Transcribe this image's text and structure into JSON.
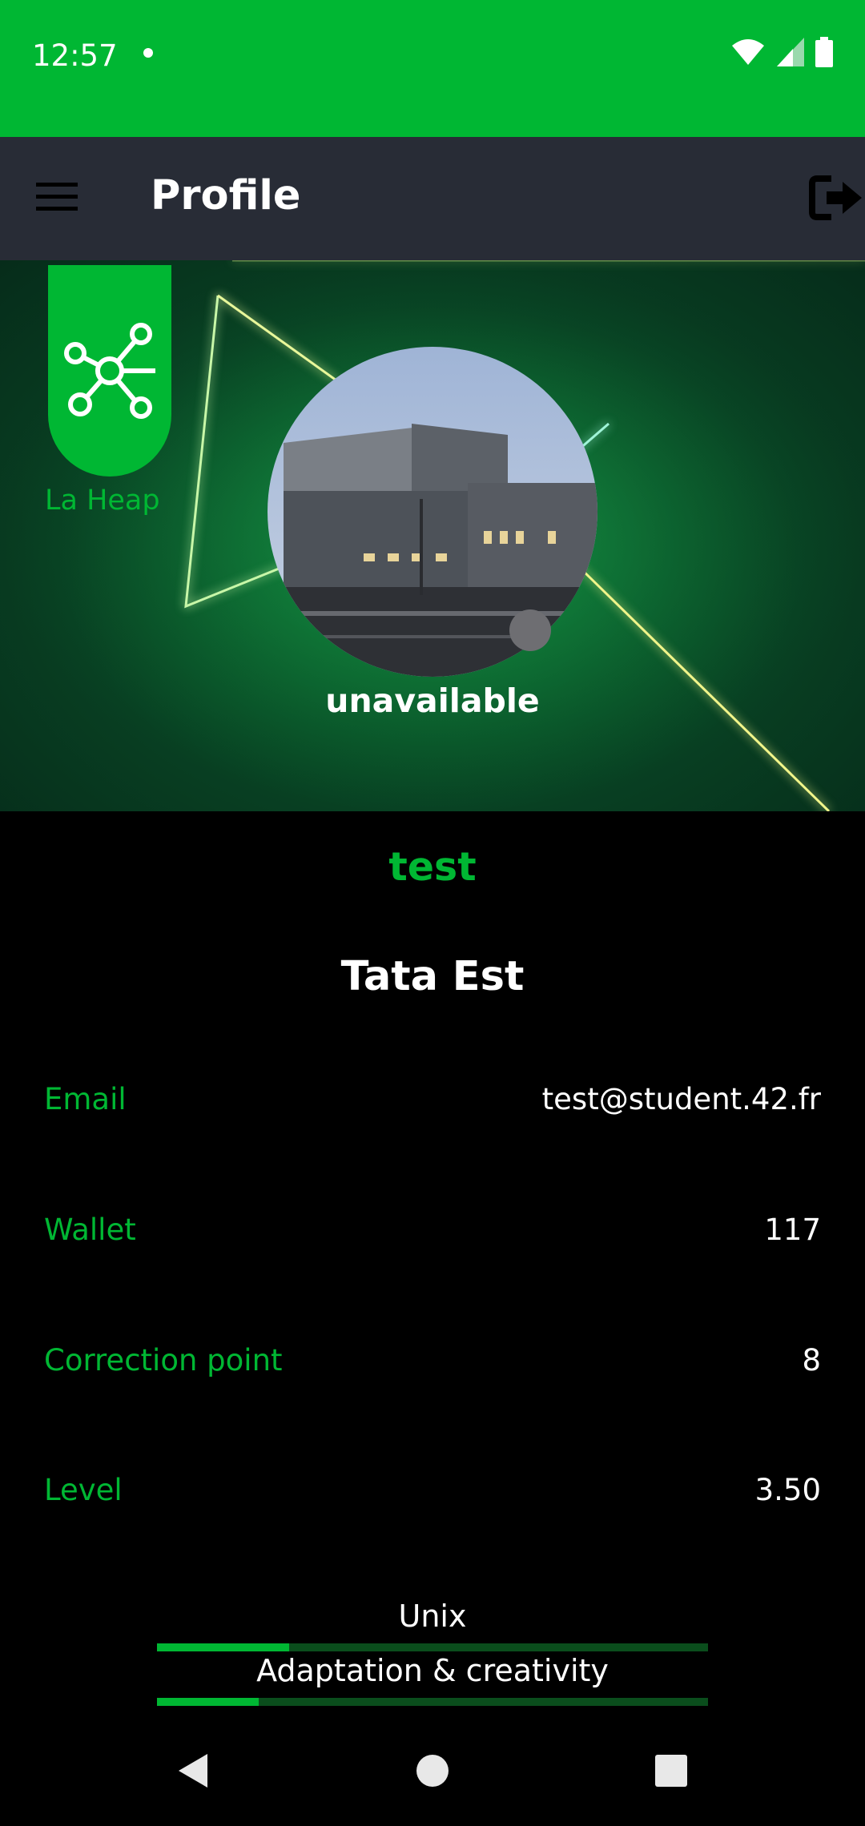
{
  "status_bar": {
    "time": "12:57"
  },
  "app_bar": {
    "title": "Profile"
  },
  "banner": {
    "coalition_name": "La Heap",
    "availability": "unavailable"
  },
  "profile": {
    "login": "test",
    "full_name": "Tata Est",
    "fields": [
      {
        "label": "Email",
        "value": "test@student.42.fr"
      },
      {
        "label": "Wallet",
        "value": "117"
      },
      {
        "label": "Correction point",
        "value": "8"
      },
      {
        "label": "Level",
        "value": "3.50"
      }
    ]
  },
  "skills": [
    {
      "name": "Unix",
      "progress": 0.24
    },
    {
      "name": "Adaptation & creativity",
      "progress": 0.185
    }
  ],
  "colors": {
    "accent": "#00b733",
    "app_bar": "#282c36",
    "background": "#000000"
  },
  "icons": [
    "wifi-icon",
    "signal-icon",
    "battery-icon",
    "menu-icon",
    "logout-icon",
    "coalition-icon",
    "back-icon",
    "home-icon",
    "recents-icon"
  ]
}
